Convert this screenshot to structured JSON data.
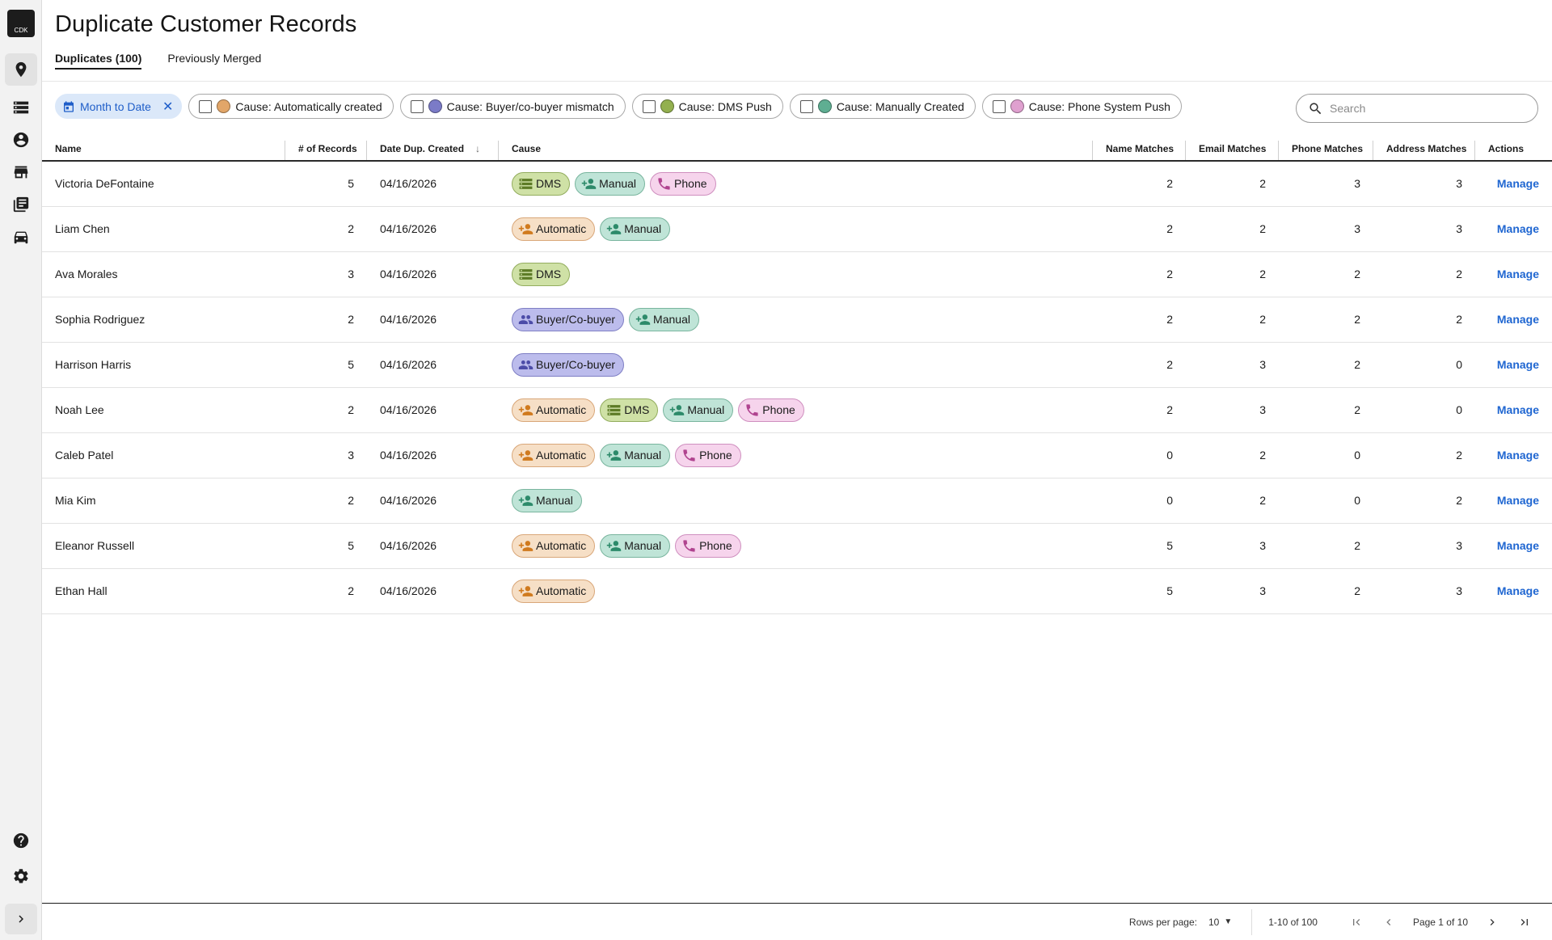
{
  "app": {
    "logo_text": "CDK",
    "title": "Duplicate Customer Records",
    "colors": {
      "accent": "#1f66d1",
      "chip_date_bg": "#dbe8f9"
    }
  },
  "sidebar": {
    "items": [
      {
        "icon": "location-pin-icon"
      },
      {
        "icon": "server-icon"
      },
      {
        "icon": "account-circle-icon"
      },
      {
        "icon": "storefront-icon"
      },
      {
        "icon": "library-books-icon"
      },
      {
        "icon": "car-icon"
      }
    ],
    "bottom": [
      {
        "icon": "help-icon"
      },
      {
        "icon": "gear-icon"
      }
    ],
    "expand_icon": "chevron-right-icon"
  },
  "tabs": [
    {
      "label": "Duplicates (100)",
      "active": true
    },
    {
      "label": "Previously Merged",
      "active": false
    }
  ],
  "filters": {
    "date_chip": "Month to Date",
    "causes": [
      {
        "label": "Cause: Automatically created",
        "color": "#e2a669"
      },
      {
        "label": "Cause: Buyer/co-buyer mismatch",
        "color": "#7b7bc7"
      },
      {
        "label": "Cause: DMS Push",
        "color": "#93b04f"
      },
      {
        "label": "Cause: Manually Created",
        "color": "#5fae92"
      },
      {
        "label": "Cause: Phone System Push",
        "color": "#dfa0cf"
      }
    ]
  },
  "search": {
    "placeholder": "Search"
  },
  "table": {
    "headers": {
      "name": "Name",
      "records": "# of Records",
      "date": "Date Dup. Created",
      "sort_indicator": "↓",
      "cause": "Cause",
      "name_matches": "Name Matches",
      "email_matches": "Email Matches",
      "phone_matches": "Phone Matches",
      "address_matches": "Address Matches",
      "actions": "Actions"
    },
    "tag_labels": {
      "auto": "Automatic",
      "dms": "DMS",
      "manual": "Manual",
      "phone": "Phone",
      "buyer": "Buyer/Co-buyer"
    },
    "action_label": "Manage",
    "rows": [
      {
        "name": "Victoria DeFontaine",
        "records": "5",
        "date": "04/16/2026",
        "causes": [
          "dms",
          "manual",
          "phone"
        ],
        "name_m": "2",
        "email_m": "2",
        "phone_m": "3",
        "addr_m": "3"
      },
      {
        "name": "Liam Chen",
        "records": "2",
        "date": "04/16/2026",
        "causes": [
          "auto",
          "manual"
        ],
        "name_m": "2",
        "email_m": "2",
        "phone_m": "3",
        "addr_m": "3"
      },
      {
        "name": "Ava Morales",
        "records": "3",
        "date": "04/16/2026",
        "causes": [
          "dms"
        ],
        "name_m": "2",
        "email_m": "2",
        "phone_m": "2",
        "addr_m": "2"
      },
      {
        "name": "Sophia Rodriguez",
        "records": "2",
        "date": "04/16/2026",
        "causes": [
          "buyer",
          "manual"
        ],
        "name_m": "2",
        "email_m": "2",
        "phone_m": "2",
        "addr_m": "2"
      },
      {
        "name": "Harrison Harris",
        "records": "5",
        "date": "04/16/2026",
        "causes": [
          "buyer"
        ],
        "name_m": "2",
        "email_m": "3",
        "phone_m": "2",
        "addr_m": "0"
      },
      {
        "name": "Noah Lee",
        "records": "2",
        "date": "04/16/2026",
        "causes": [
          "auto",
          "dms",
          "manual",
          "phone"
        ],
        "name_m": "2",
        "email_m": "3",
        "phone_m": "2",
        "addr_m": "0"
      },
      {
        "name": "Caleb Patel",
        "records": "3",
        "date": "04/16/2026",
        "causes": [
          "auto",
          "manual",
          "phone"
        ],
        "name_m": "0",
        "email_m": "2",
        "phone_m": "0",
        "addr_m": "2"
      },
      {
        "name": "Mia Kim",
        "records": "2",
        "date": "04/16/2026",
        "causes": [
          "manual"
        ],
        "name_m": "0",
        "email_m": "2",
        "phone_m": "0",
        "addr_m": "2"
      },
      {
        "name": "Eleanor Russell",
        "records": "5",
        "date": "04/16/2026",
        "causes": [
          "auto",
          "manual",
          "phone"
        ],
        "name_m": "5",
        "email_m": "3",
        "phone_m": "2",
        "addr_m": "3"
      },
      {
        "name": "Ethan Hall",
        "records": "2",
        "date": "04/16/2026",
        "causes": [
          "auto"
        ],
        "name_m": "5",
        "email_m": "3",
        "phone_m": "2",
        "addr_m": "3"
      }
    ]
  },
  "pagination": {
    "rows_per_page_label": "Rows per page:",
    "rows_per_page_value": "10",
    "range": "1-10 of 100",
    "page_info": "Page 1 of 10"
  }
}
